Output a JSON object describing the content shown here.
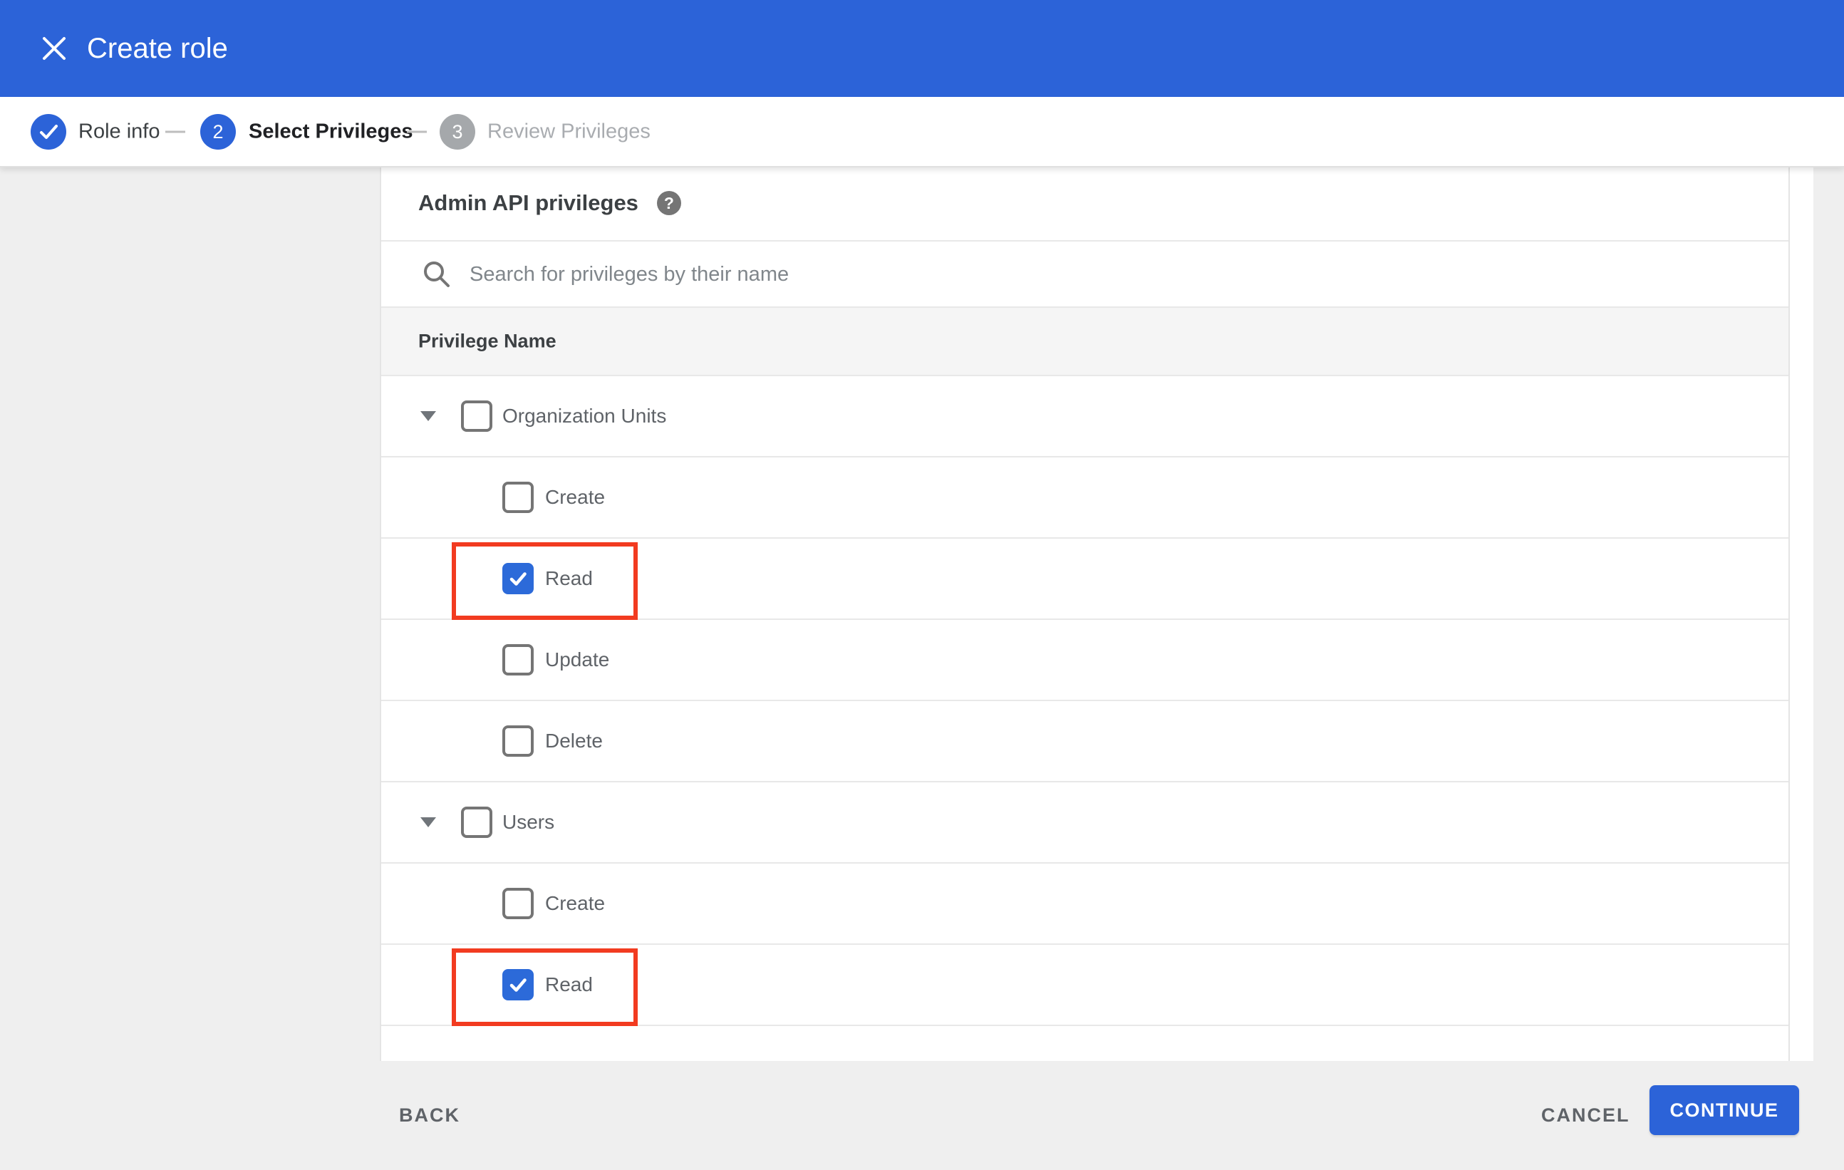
{
  "header": {
    "title": "Create role"
  },
  "stepper": {
    "steps": [
      {
        "label": "Role info",
        "status": "completed",
        "icon": "check-icon"
      },
      {
        "number": "2",
        "label": "Select Privileges",
        "status": "current"
      },
      {
        "number": "3",
        "label": "Review Privileges",
        "status": "upcoming"
      }
    ]
  },
  "main": {
    "section_title": "Admin API privileges",
    "help_glyph": "?",
    "search_placeholder": "Search for privileges by their name",
    "table_header": "Privilege Name",
    "rows": [
      {
        "label": "Organization Units",
        "level": "group",
        "checked": false,
        "highlighted": false
      },
      {
        "label": "Create",
        "level": "child",
        "checked": false,
        "highlighted": false
      },
      {
        "label": "Read",
        "level": "child",
        "checked": true,
        "highlighted": true
      },
      {
        "label": "Update",
        "level": "child",
        "checked": false,
        "highlighted": false
      },
      {
        "label": "Delete",
        "level": "child",
        "checked": false,
        "highlighted": false
      },
      {
        "label": "Users",
        "level": "group",
        "checked": false,
        "highlighted": false
      },
      {
        "label": "Create",
        "level": "child",
        "checked": false,
        "highlighted": false
      },
      {
        "label": "Read",
        "level": "child",
        "checked": true,
        "highlighted": true
      }
    ]
  },
  "footer": {
    "back_label": "BACK",
    "cancel_label": "CANCEL",
    "continue_label": "CONTINUE"
  },
  "icons": {
    "close": "close-icon",
    "step_complete": "check-icon",
    "search": "search-icon",
    "help": "help-circle-icon",
    "expand": "triangle-down-icon",
    "checked": "check-icon"
  },
  "colors": {
    "primary_blue": "#2c63d8",
    "checkbox_blue": "#2c6ad9",
    "annotation_red": "#f23b20",
    "page_background": "#efefef",
    "card_background": "#ffffff",
    "table_header_background": "#f5f5f5",
    "divider": "#e8e8e8",
    "text_dark": "#3c4043",
    "text_gray": "#5f6368",
    "step_upcoming_gray": "#a5a8ab"
  }
}
